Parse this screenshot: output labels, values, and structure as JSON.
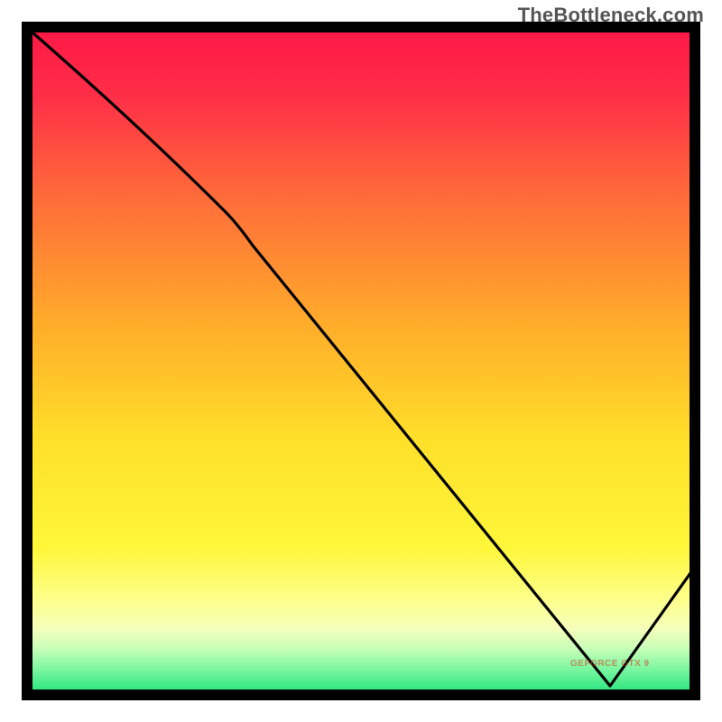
{
  "watermark": "TheBottleneck.com",
  "chart_data": {
    "type": "line",
    "title": "",
    "xlabel": "",
    "ylabel": "",
    "xlim": [
      0,
      1
    ],
    "ylim": [
      0,
      1
    ],
    "grid": false,
    "legend": false,
    "background_gradient": {
      "direction": "top-to-bottom",
      "stops": [
        {
          "pos": 0.0,
          "color": "#ff1846"
        },
        {
          "pos": 0.1,
          "color": "#ff2d48"
        },
        {
          "pos": 0.25,
          "color": "#ff6a3a"
        },
        {
          "pos": 0.45,
          "color": "#ffae2a"
        },
        {
          "pos": 0.62,
          "color": "#ffe02a"
        },
        {
          "pos": 0.78,
          "color": "#fff73a"
        },
        {
          "pos": 0.86,
          "color": "#fdff8e"
        },
        {
          "pos": 0.9,
          "color": "#f6ffba"
        },
        {
          "pos": 0.93,
          "color": "#c9ffb9"
        },
        {
          "pos": 0.96,
          "color": "#7ff7a2"
        },
        {
          "pos": 1.0,
          "color": "#1fe27a"
        }
      ]
    },
    "series": [
      {
        "name": "GEFORCE GTX 9",
        "color": "#000000",
        "x": [
          0.0,
          0.1,
          0.2,
          0.3,
          0.4,
          0.5,
          0.6,
          0.7,
          0.8,
          0.87,
          0.95,
          1.0
        ],
        "y": [
          1.0,
          0.91,
          0.82,
          0.72,
          0.58,
          0.46,
          0.33,
          0.21,
          0.09,
          0.01,
          0.1,
          0.19
        ]
      }
    ],
    "notes": "Line starts at top-left, descends with a slight curvature change around x≈0.28–0.32, reaches the bottom near x≈0.87 where a small red label sits, then rises toward x=1."
  }
}
